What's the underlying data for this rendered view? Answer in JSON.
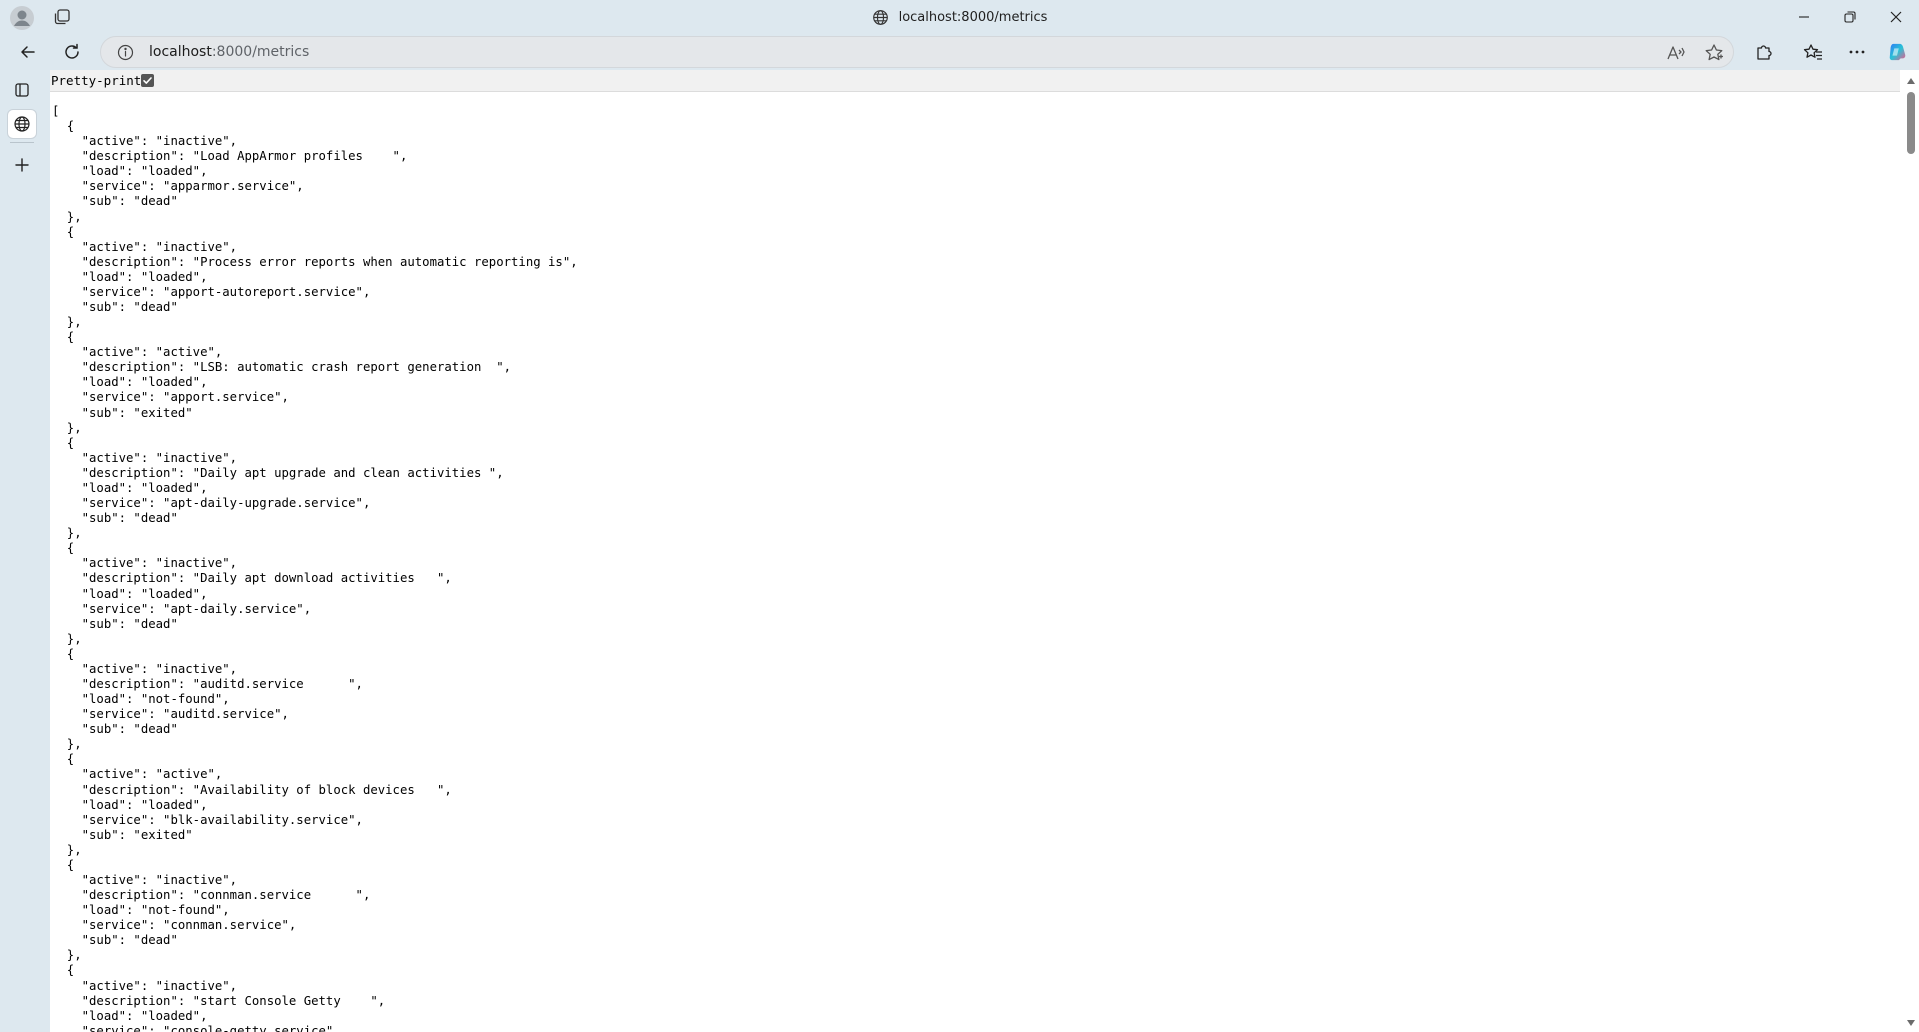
{
  "window": {
    "title": "localhost:8000/metrics",
    "icons": {
      "profile": "profile-avatar-icon",
      "tabs": "tab-actions-icon",
      "site": "globe-icon",
      "minimize": "minimize-icon",
      "restore": "restore-icon",
      "close": "close-icon"
    }
  },
  "toolbar": {
    "url_host": "localhost",
    "url_path": ":8000/metrics",
    "icons": [
      "back-icon",
      "refresh-icon",
      "site-info-icon",
      "read-aloud-icon",
      "favorite-star-icon",
      "extensions-icon",
      "favorites-icon",
      "more-icon",
      "copilot-icon"
    ]
  },
  "sidebar": {
    "icons": [
      "vertical-tabs-icon",
      "globe-tab-icon",
      "new-tab-plus-icon"
    ]
  },
  "viewer": {
    "pretty_print_label": "Pretty-print",
    "pretty_print_checked": true,
    "json_text": "[\n  {\n    \"active\": \"inactive\",\n    \"description\": \"Load AppArmor profiles    \",\n    \"load\": \"loaded\",\n    \"service\": \"apparmor.service\",\n    \"sub\": \"dead\"\n  },\n  {\n    \"active\": \"inactive\",\n    \"description\": \"Process error reports when automatic reporting is\",\n    \"load\": \"loaded\",\n    \"service\": \"apport-autoreport.service\",\n    \"sub\": \"dead\"\n  },\n  {\n    \"active\": \"active\",\n    \"description\": \"LSB: automatic crash report generation  \",\n    \"load\": \"loaded\",\n    \"service\": \"apport.service\",\n    \"sub\": \"exited\"\n  },\n  {\n    \"active\": \"inactive\",\n    \"description\": \"Daily apt upgrade and clean activities \",\n    \"load\": \"loaded\",\n    \"service\": \"apt-daily-upgrade.service\",\n    \"sub\": \"dead\"\n  },\n  {\n    \"active\": \"inactive\",\n    \"description\": \"Daily apt download activities   \",\n    \"load\": \"loaded\",\n    \"service\": \"apt-daily.service\",\n    \"sub\": \"dead\"\n  },\n  {\n    \"active\": \"inactive\",\n    \"description\": \"auditd.service      \",\n    \"load\": \"not-found\",\n    \"service\": \"auditd.service\",\n    \"sub\": \"dead\"\n  },\n  {\n    \"active\": \"active\",\n    \"description\": \"Availability of block devices   \",\n    \"load\": \"loaded\",\n    \"service\": \"blk-availability.service\",\n    \"sub\": \"exited\"\n  },\n  {\n    \"active\": \"inactive\",\n    \"description\": \"connman.service      \",\n    \"load\": \"not-found\",\n    \"service\": \"connman.service\",\n    \"sub\": \"dead\"\n  },\n  {\n    \"active\": \"inactive\",\n    \"description\": \"start Console Getty    \",\n    \"load\": \"loaded\",\n    \"service\": \"console-getty.service\""
  }
}
